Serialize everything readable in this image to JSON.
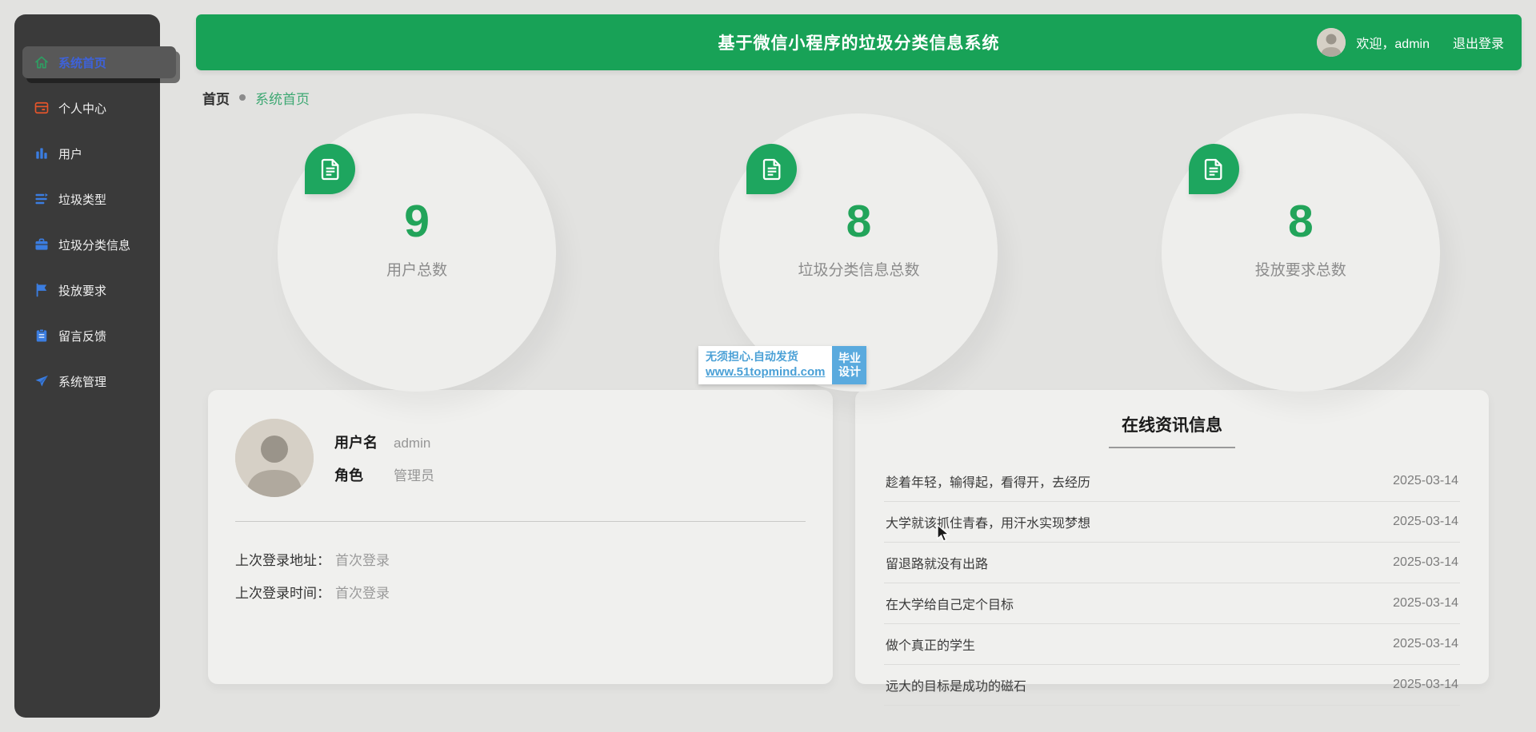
{
  "app": {
    "title": "基于微信小程序的垃圾分类信息系统",
    "welcome": "欢迎，admin",
    "logout": "退出登录"
  },
  "sidebar": {
    "items": [
      {
        "label": "系统首页",
        "icon": "home-icon",
        "active": true
      },
      {
        "label": "个人中心",
        "icon": "postcard-icon",
        "active": false
      },
      {
        "label": "用户",
        "icon": "bar-chart-icon",
        "active": false
      },
      {
        "label": "垃圾类型",
        "icon": "list-icon",
        "active": false
      },
      {
        "label": "垃圾分类信息",
        "icon": "briefcase-icon",
        "active": false
      },
      {
        "label": "投放要求",
        "icon": "flag-icon",
        "active": false
      },
      {
        "label": "留言反馈",
        "icon": "clipboard-icon",
        "active": false
      },
      {
        "label": "系统管理",
        "icon": "paper-plane-icon",
        "active": false
      }
    ]
  },
  "breadcrumb": {
    "home": "首页",
    "current": "系统首页"
  },
  "stats": [
    {
      "value": "9",
      "label": "用户总数"
    },
    {
      "value": "8",
      "label": "垃圾分类信息总数"
    },
    {
      "value": "8",
      "label": "投放要求总数"
    }
  ],
  "watermark": {
    "line1": "无须担心.自动发货",
    "line2": "www.51topmind.com",
    "badge_line1": "毕业",
    "badge_line2": "设计"
  },
  "profile": {
    "username_label": "用户名",
    "username": "admin",
    "role_label": "角色",
    "role": "管理员",
    "last_login_addr_label": "上次登录地址：",
    "last_login_addr": "首次登录",
    "last_login_time_label": "上次登录时间：",
    "last_login_time": "首次登录"
  },
  "news": {
    "title": "在线资讯信息",
    "items": [
      {
        "text": "趁着年轻，输得起，看得开，去经历",
        "date": "2025-03-14"
      },
      {
        "text": "大学就该抓住青春，用汗水实现梦想",
        "date": "2025-03-14"
      },
      {
        "text": "留退路就没有出路",
        "date": "2025-03-14"
      },
      {
        "text": "在大学给自己定个目标",
        "date": "2025-03-14"
      },
      {
        "text": "做个真正的学生",
        "date": "2025-03-14"
      },
      {
        "text": "远大的目标是成功的磁石",
        "date": "2025-03-14"
      }
    ]
  },
  "colors": {
    "header_green": "#18a257",
    "badge_green": "#1ea65f",
    "stat_number_green": "#22a45a",
    "breadcrumb_green": "#3ea873",
    "sidebar_bg": "#3a3a3a",
    "active_item_text_blue": "#3e62d9",
    "icon_blue": "#3b7de0",
    "icon_orange": "#e5552b",
    "icon_green": "#2e9e62",
    "watermark_blue": "#5aaade",
    "page_bg": "#e2e2e0",
    "card_bg": "#f0f0ee"
  }
}
